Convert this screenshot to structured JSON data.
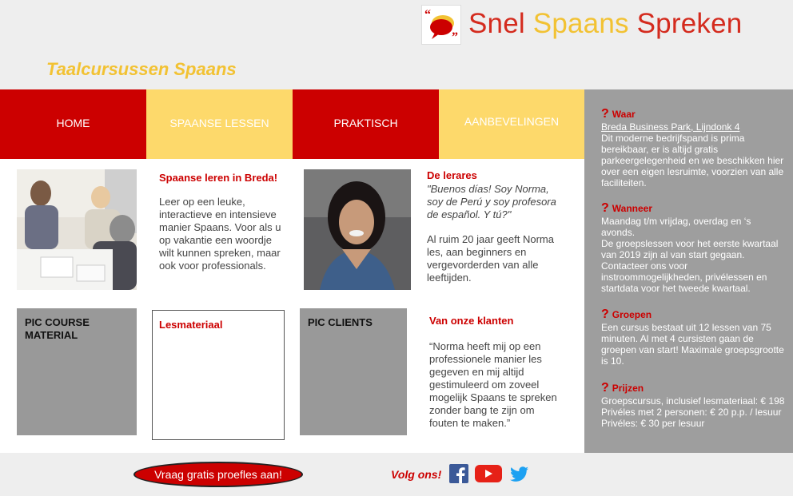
{
  "header": {
    "logo_word1": "Snel",
    "logo_word2": "Spaans",
    "logo_word3": "Spreken",
    "tagline": "Taalcursussen Spaans"
  },
  "nav": {
    "items": [
      {
        "label": "HOME"
      },
      {
        "label": "SPAANSE LESSEN"
      },
      {
        "label": "PRAKTISCH"
      },
      {
        "label": "AANBEVELINGEN"
      }
    ]
  },
  "main": {
    "breda_title": "Spaanse leren in Breda!",
    "breda_text": "Leer op een leuke, interactieve en intensieve manier Spaans. Voor als u op vakantie een woordje wilt kunnen spreken, maar ook voor professionals.",
    "teacher_title": "De lerares",
    "teacher_quote": "\"Buenos días! Soy Norma, soy de Perú y soy profesora de español. Y tú?\"",
    "teacher_text": "Al ruim 20 jaar geeft Norma les, aan beginners en vergevorderden van alle leeftijden.",
    "course_material_box": "PIC COURSE MATERIAL",
    "lesmateriaal_title": "Lesmateriaal",
    "clients_box": "PIC CLIENTS",
    "clients_title": "Van onze klanten",
    "clients_quote": "“Norma heeft mij op een professionele manier les gegeven en mij altijd gestimuleerd om zoveel mogelijk Spaans te spreken zonder bang te zijn om fouten te maken.”"
  },
  "sidebar": {
    "waar_title": "Waar",
    "waar_link": "Breda Business Park, Lijndonk 4",
    "waar_text": "Dit moderne bedrijfspand is prima bereikbaar, er is altijd gratis parkeergelegenheid en we beschikken hier over een eigen lesruimte, voorzien van alle faciliteiten.",
    "wanneer_title": "Wanneer",
    "wanneer_text1": "Maandag t/m vrijdag, overdag en ‘s avonds.",
    "wanneer_text2": "De groepslessen voor het eerste kwartaal van 2019 zijn al van start gegaan.",
    "wanneer_text3": "Contacteer ons voor instroommogelijkheden, privélessen en startdata voor het tweede kwartaal.",
    "groepen_title": "Groepen",
    "groepen_text": "Een cursus bestaat uit 12 lessen van 75 minuten. Al met 4 cursisten gaan de groepen van start! Maximale groepsgrootte is 10.",
    "prijzen_title": "Prijzen",
    "prijzen_text1": "Groepscursus, inclusief lesmateriaal: € 198",
    "prijzen_text2": "Privéles met 2 personen: € 20 p.p. / lesuur",
    "prijzen_text3": "Privéles: € 30 per lesuur",
    "question_mark": "?"
  },
  "footer": {
    "trial_button": "Vraag gratis proefles aan!",
    "follow_label": "Volg ons!"
  },
  "colors": {
    "red": "#cc0000",
    "yellow": "#fdd96b",
    "gold_text": "#f2c233",
    "sidebar_gray": "#9e9e9e"
  }
}
